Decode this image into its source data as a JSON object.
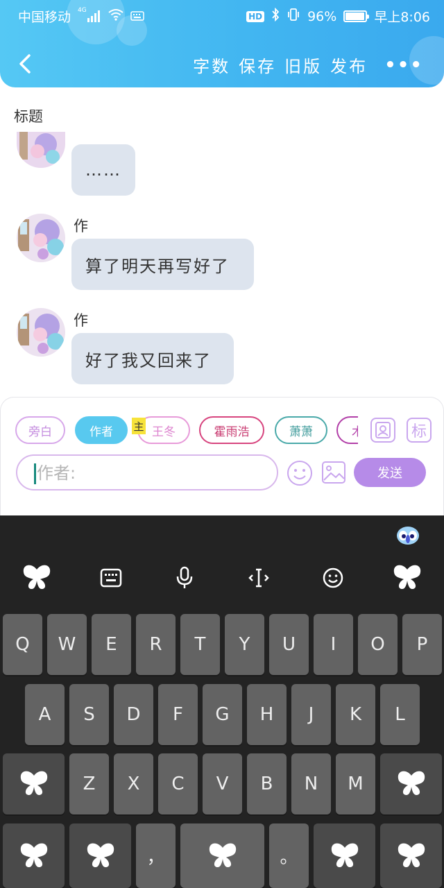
{
  "status_bar": {
    "carrier": "中国移动",
    "network": "4G",
    "hd_badge": "HD",
    "battery_percent": "96%",
    "battery_level": 0.96,
    "time": "早上8:06"
  },
  "header": {
    "actions": [
      "字数",
      "保存",
      "旧版",
      "发布"
    ],
    "more": "•••"
  },
  "page": {
    "title_label": "标题"
  },
  "messages": [
    {
      "author": "",
      "text": "……"
    },
    {
      "author": "作者",
      "text": "算了明天再写好了"
    },
    {
      "author": "作者",
      "text": "好了我又回来了"
    }
  ],
  "characters": {
    "chips": [
      "旁白",
      "作者",
      "王冬",
      "霍雨浩",
      "萧萧",
      "木"
    ],
    "selected": "作者",
    "main_badge": "主"
  },
  "composer": {
    "placeholder": "作者:",
    "send_label": "发送",
    "side_button_tag": "标"
  },
  "keyboard": {
    "row1": [
      "Q",
      "W",
      "E",
      "R",
      "T",
      "Y",
      "U",
      "I",
      "O",
      "P"
    ],
    "row2": [
      "A",
      "S",
      "D",
      "F",
      "G",
      "H",
      "J",
      "K",
      "L"
    ],
    "row3": [
      "Z",
      "X",
      "C",
      "V",
      "B",
      "N",
      "M"
    ],
    "comma": "，",
    "period": "。"
  },
  "colors": {
    "header": "#42b6f1",
    "chip_selected": "#58c9ef",
    "send": "#b68be8",
    "keyboard_bg": "#232323",
    "key": "#636363"
  }
}
